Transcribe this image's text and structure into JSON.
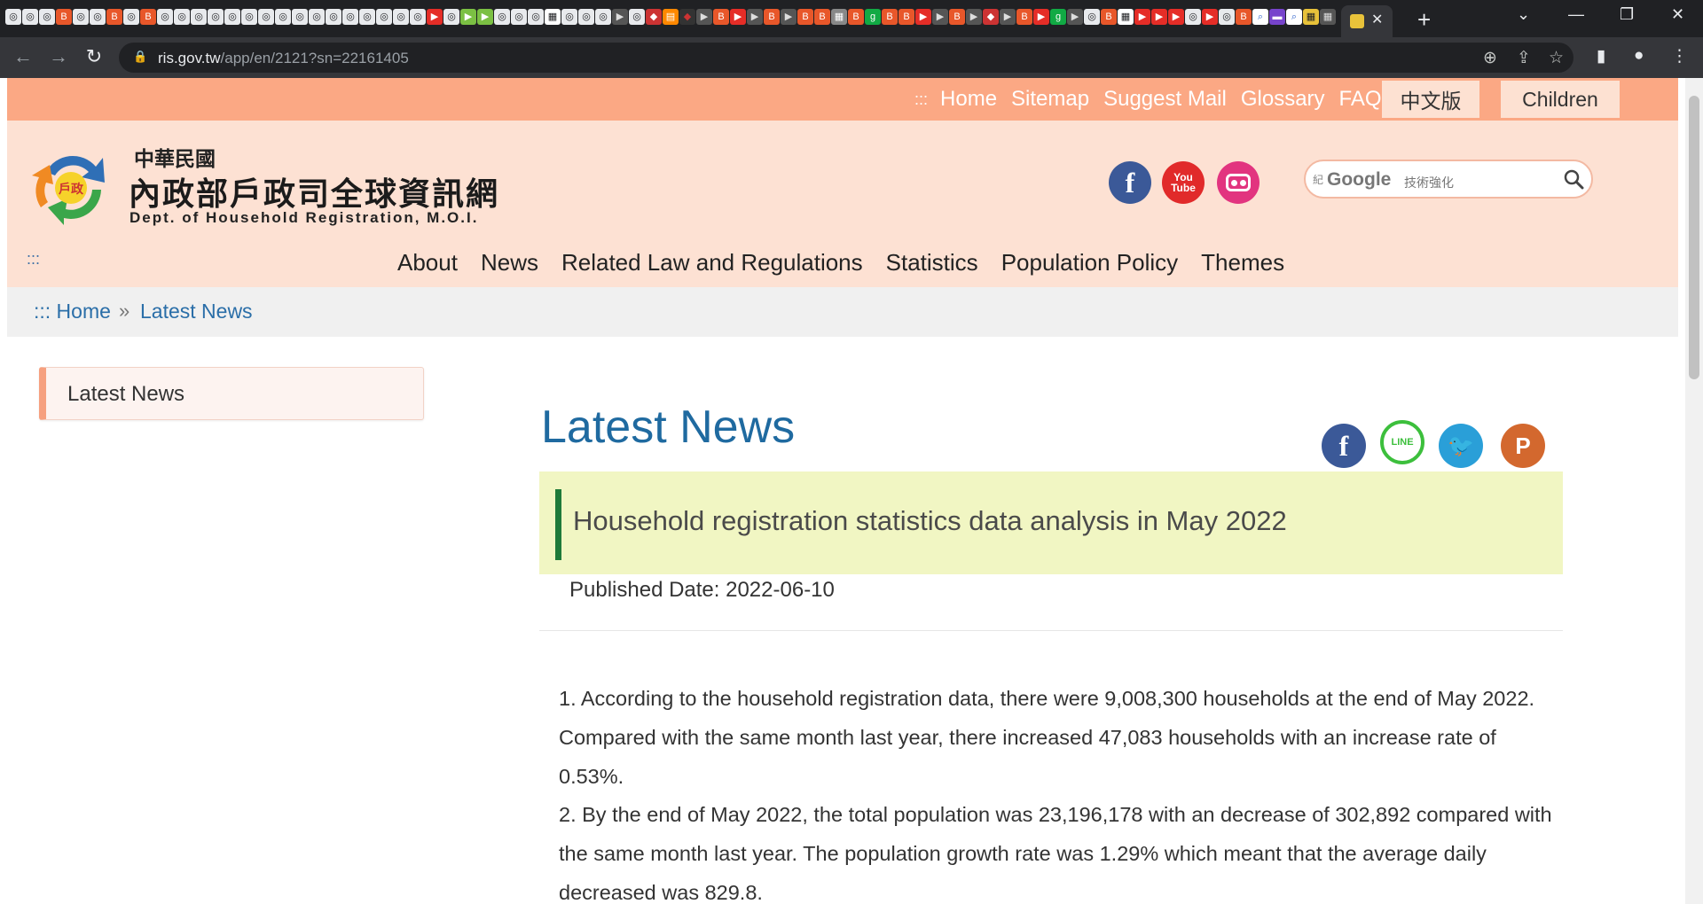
{
  "browser": {
    "url_domain": "ris.gov.tw",
    "url_path": "/app/en/2121?sn=22161405"
  },
  "topbar": {
    "dots": ":::",
    "links": [
      "Home",
      "Sitemap",
      "Suggest Mail",
      "Glossary",
      "FAQs"
    ],
    "chinese_version": "中文版",
    "children": "Children"
  },
  "header": {
    "org_cn_small": "中華民國",
    "org_cn_big": "內政部戶政司全球資訊網",
    "org_en": "Dept. of Household Registration, M.O.I.",
    "search_prefix": "紀",
    "search_google": "Google",
    "search_suffix": "技術強化"
  },
  "mainnav": {
    "dots": ":::",
    "items": [
      "About",
      "News",
      "Related Law and Regulations",
      "Statistics",
      "Population Policy",
      "Themes"
    ]
  },
  "breadcrumb": {
    "home": "::: Home",
    "sep": "»",
    "current": "Latest News"
  },
  "sidebar": {
    "item": "Latest News"
  },
  "article": {
    "heading": "Latest News",
    "title": "Household registration statistics data analysis in May 2022",
    "published": "Published Date: 2022-06-10",
    "paragraphs": [
      "1. According to the household registration data, there were 9,008,300 households at the end of May 2022. Compared with the same month last year, there increased 47,083 households with an increase rate of 0.53%.",
      "2. By the end of May 2022, the total population was 23,196,178 with an decrease of 302,892 compared with the same month last year. The population growth rate was 1.29% which meant that the average daily decreased was 829.8."
    ]
  },
  "colors": {
    "topbar": "#fba884",
    "header_bg": "#fde1d3",
    "heading_blue": "#1f6aa0",
    "title_bg": "#f1f6c3",
    "title_bar": "#1e7a3a"
  }
}
